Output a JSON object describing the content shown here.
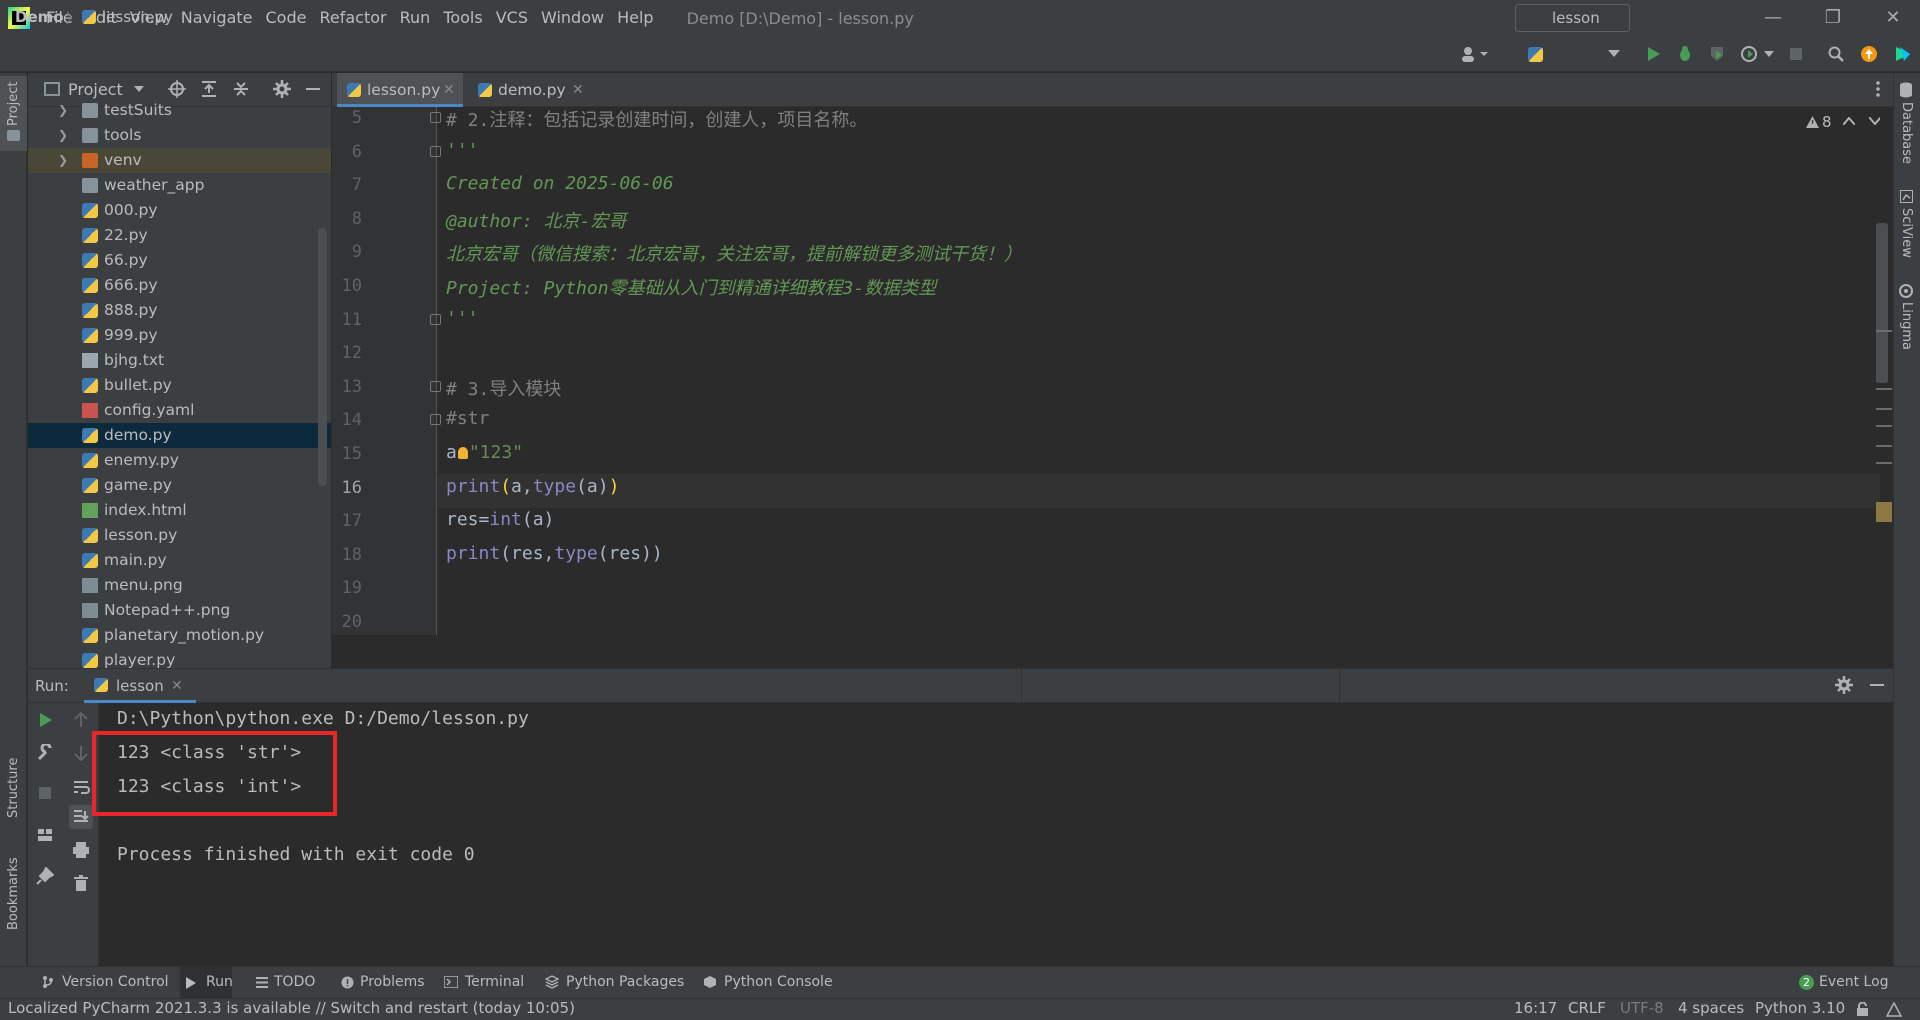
{
  "menu": [
    "File",
    "Edit",
    "View",
    "Navigate",
    "Code",
    "Refactor",
    "Run",
    "Tools",
    "VCS",
    "Window",
    "Help"
  ],
  "window_title": "Demo [D:\\Demo] - lesson.py",
  "breadcrumb": {
    "project": "Demo",
    "file": "lesson.py"
  },
  "run_config": "lesson",
  "left_strip": {
    "project": "Project",
    "structure": "Structure",
    "bookmarks": "Bookmarks"
  },
  "right_strip": {
    "database": "Database",
    "sciview": "SciView",
    "lingma": "Lingma"
  },
  "project_panel": {
    "title": "Project",
    "items": [
      {
        "name": "testSuits",
        "type": "folder",
        "expandable": true
      },
      {
        "name": "tools",
        "type": "folder",
        "expandable": true
      },
      {
        "name": "venv",
        "type": "folder-excluded",
        "expandable": true
      },
      {
        "name": "weather_app",
        "type": "folder",
        "expandable": false
      },
      {
        "name": "000.py",
        "type": "py"
      },
      {
        "name": "22.py",
        "type": "py"
      },
      {
        "name": "66.py",
        "type": "py"
      },
      {
        "name": "666.py",
        "type": "py"
      },
      {
        "name": "888.py",
        "type": "py"
      },
      {
        "name": "999.py",
        "type": "py"
      },
      {
        "name": "bjhg.txt",
        "type": "txt"
      },
      {
        "name": "bullet.py",
        "type": "py"
      },
      {
        "name": "config.yaml",
        "type": "yaml"
      },
      {
        "name": "demo.py",
        "type": "py",
        "selected": true
      },
      {
        "name": "enemy.py",
        "type": "py"
      },
      {
        "name": "game.py",
        "type": "py"
      },
      {
        "name": "index.html",
        "type": "html"
      },
      {
        "name": "lesson.py",
        "type": "py"
      },
      {
        "name": "main.py",
        "type": "py"
      },
      {
        "name": "menu.png",
        "type": "png"
      },
      {
        "name": "Notepad++.png",
        "type": "png"
      },
      {
        "name": "planetary_motion.py",
        "type": "py"
      },
      {
        "name": "player.py",
        "type": "py"
      }
    ]
  },
  "editor_tabs": [
    {
      "label": "lesson.py",
      "active": true
    },
    {
      "label": "demo.py",
      "active": false
    }
  ],
  "inspection": {
    "warnings": "8"
  },
  "editor": {
    "current_line": 16,
    "lines": [
      {
        "n": "5",
        "text": "# 2.注释：包括记录创建时间，创建人，项目名称。"
      },
      {
        "n": "6",
        "text": "'''"
      },
      {
        "n": "7",
        "text": "Created on 2025-06-06"
      },
      {
        "n": "8",
        "text": "@author: 北京-宏哥"
      },
      {
        "n": "9",
        "text": "北京宏哥（微信搜索：北京宏哥，关注宏哥，提前解锁更多测试干货！）"
      },
      {
        "n": "10",
        "text": "Project: Python零基础从入门到精通详细教程3-数据类型"
      },
      {
        "n": "11",
        "text": "'''"
      },
      {
        "n": "12",
        "text": ""
      },
      {
        "n": "13",
        "text": "# 3.导入模块"
      },
      {
        "n": "14",
        "text": "#str"
      },
      {
        "n": "15",
        "a": "a",
        "b": "=",
        "c": "\"123\""
      },
      {
        "n": "16",
        "text": "print(a,type(a))"
      },
      {
        "n": "17",
        "text": "res=int(a)"
      },
      {
        "n": "18",
        "text": "print(res,type(res))"
      },
      {
        "n": "19",
        "text": ""
      },
      {
        "n": "20",
        "text": ""
      }
    ]
  },
  "run_panel": {
    "label": "Run:",
    "tab": "lesson",
    "console": [
      "D:\\Python\\python.exe D:/Demo/lesson.py",
      "123 <class 'str'>",
      "123 <class 'int'>",
      "",
      "Process finished with exit code 0"
    ]
  },
  "tool_tabs": [
    "Version Control",
    "Run",
    "TODO",
    "Problems",
    "Terminal",
    "Python Packages",
    "Python Console"
  ],
  "event_log": {
    "count": "2",
    "label": "Event Log"
  },
  "status": {
    "message": "Localized PyCharm 2021.3.3 is available // Switch and restart (today 10:05)",
    "position": "16:17",
    "line_sep": "CRLF",
    "encoding": "UTF-8",
    "indent": "4 spaces",
    "interpreter": "Python 3.10"
  },
  "colors": {
    "accent": "#4a88c7",
    "highlight_box": "#e8262b",
    "selection": "#0d293e"
  }
}
